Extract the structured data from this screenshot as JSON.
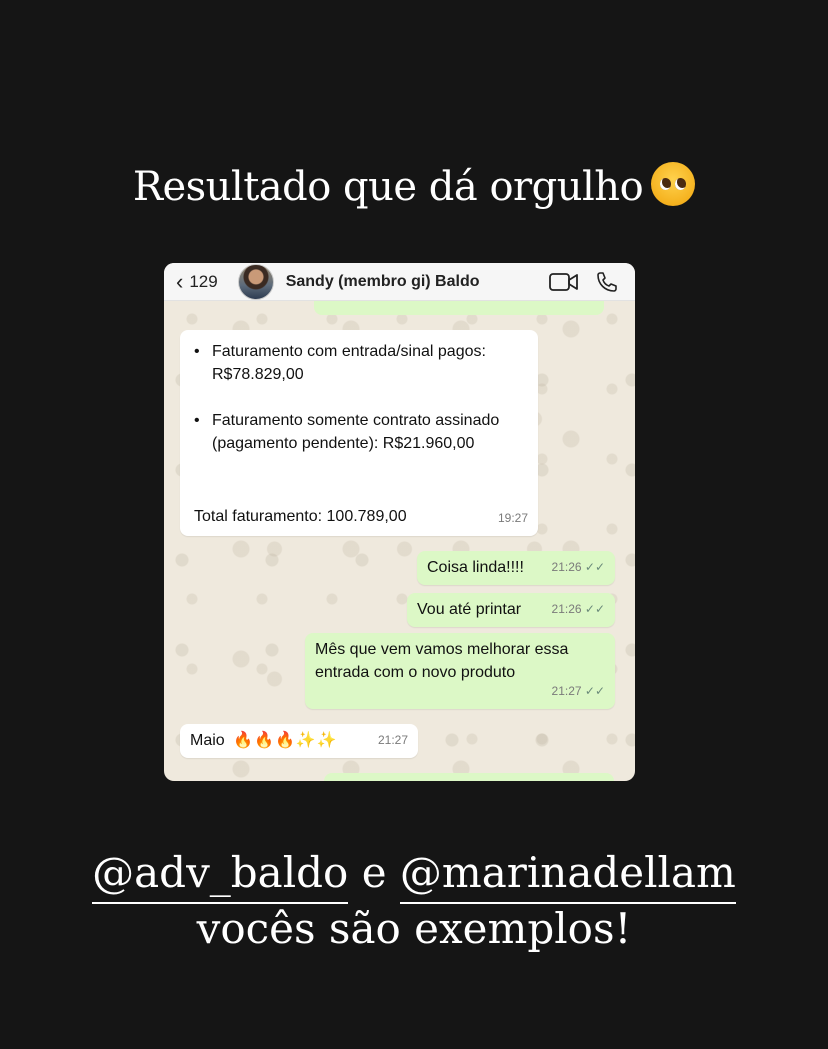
{
  "headline": {
    "text": "Resultado que dá orgulho",
    "emoji": "pleading-face-emoji"
  },
  "chat": {
    "back_count": "129",
    "contact_name": "Sandy (membro gi) Baldo",
    "icons": [
      "chevron-left-icon",
      "avatar",
      "video-call-icon",
      "phone-icon"
    ],
    "messages": [
      {
        "direction": "in",
        "items": [
          "Faturamento com entrada/sinal pagos: R$78.829,00",
          "Faturamento somente contrato assinado (pagamento pendente): R$21.960,00"
        ],
        "total": "Total faturamento: 100.789,00",
        "time": "19:27"
      },
      {
        "direction": "out",
        "text": "Coisa linda!!!!",
        "time": "21:26"
      },
      {
        "direction": "out",
        "text": "Vou até printar",
        "time": "21:26"
      },
      {
        "direction": "out",
        "text": "Mês que vem vamos melhorar essa entrada com o novo produto",
        "time": "21:27"
      },
      {
        "direction": "in",
        "text": "Maio",
        "emojis": "🔥🔥🔥✨✨",
        "time": "21:27"
      }
    ],
    "colors": {
      "incoming": "#ffffff",
      "outgoing": "#dcf8c6",
      "background": "#efe9dd"
    }
  },
  "footer": {
    "mention1": "@adv_baldo",
    "connector": "e",
    "mention2": "@marinadellam",
    "line2": "vocês são exemplos!"
  }
}
